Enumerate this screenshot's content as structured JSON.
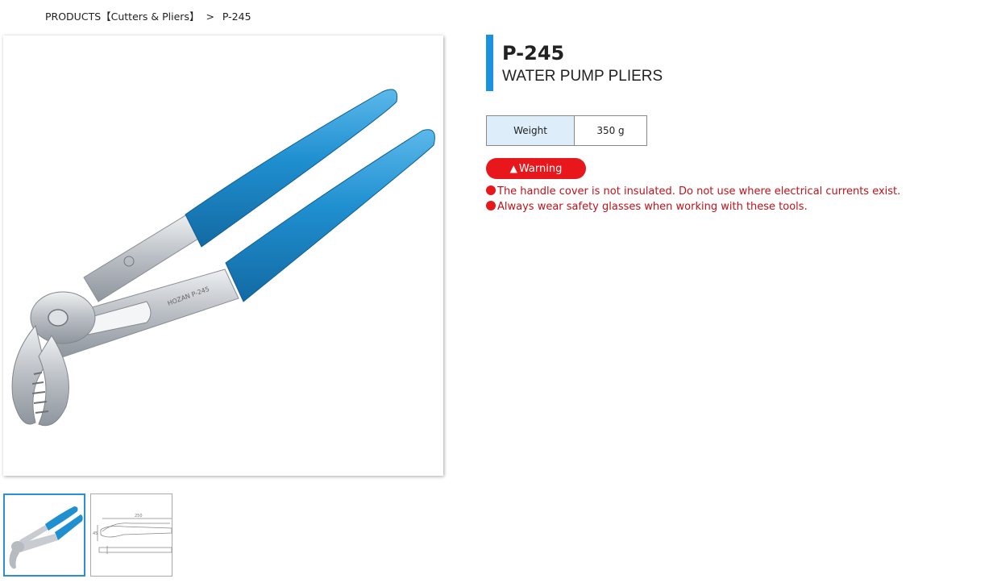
{
  "breadcrumb": {
    "category": "PRODUCTS【Cutters & Pliers】",
    "separator": ">",
    "current": "P-245"
  },
  "product": {
    "code": "P-245",
    "name": "WATER PUMP PLIERS"
  },
  "specs": [
    {
      "label": "Weight",
      "value": "350 g"
    }
  ],
  "warning": {
    "badge_icon": "warning-triangle-icon",
    "badge_label": "Warning",
    "items": [
      "The handle cover is not insulated. Do not use where electrical currents exist.",
      "Always wear safety glasses when working with these tools."
    ]
  },
  "images": {
    "main": "pliers-photo",
    "thumbnails": [
      "pliers-photo-thumbnail",
      "pliers-dimension-drawing-thumbnail"
    ]
  },
  "drawing_labels": [
    "250",
    "45"
  ],
  "colors": {
    "accent": "#1a92e0",
    "handle_blue": "#1f8fd0",
    "warning_red": "#e8171b",
    "warning_text": "#c0121a",
    "spec_label_bg": "#ddeefa"
  }
}
